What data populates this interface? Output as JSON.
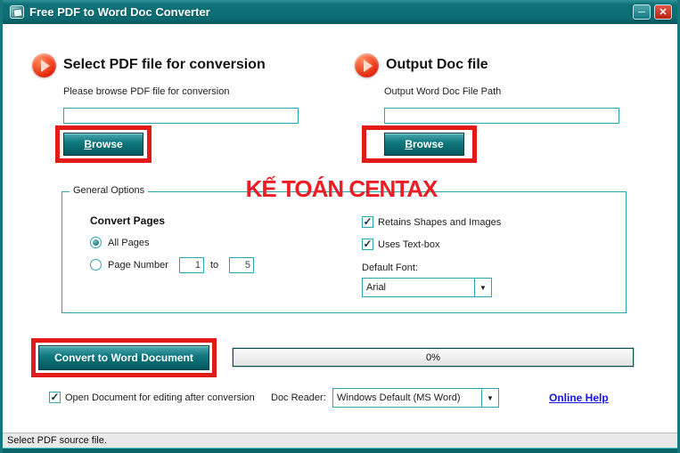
{
  "window": {
    "title": "Free PDF to Word Doc Converter"
  },
  "icons": {
    "minimize": "─",
    "close": "✕",
    "dropdown_arrow": "▼",
    "check": "✓"
  },
  "sections": {
    "pdf": {
      "heading": "Select PDF file for conversion",
      "label": "Please browse PDF file for conversion",
      "input_value": "",
      "browse_underletter": "B",
      "browse_rest": "rowse"
    },
    "doc": {
      "heading": "Output Doc file",
      "label": "Output Word Doc File Path",
      "input_value": "",
      "browse_underletter": "B",
      "browse_rest": "rowse"
    }
  },
  "watermark": "KẾ TOÁN CENTAX",
  "general_options": {
    "legend": "General Options",
    "convert_pages_label": "Convert Pages",
    "all_pages_label": "All Pages",
    "page_number_label": "Page Number",
    "page_from": "1",
    "to_label": "to",
    "page_to": "5",
    "retains_label": "Retains Shapes and Images",
    "textbox_label": "Uses Text-box",
    "default_font_label": "Default Font:",
    "default_font_value": "Arial"
  },
  "actions": {
    "convert_label": "Convert to Word Document",
    "progress_value": "0%",
    "open_doc_label": "Open Document for editing after conversion",
    "doc_reader_label": "Doc Reader:",
    "doc_reader_value": "Windows Default (MS Word)",
    "online_help_label": "Online Help"
  },
  "status_bar": {
    "text": "Select PDF source file."
  },
  "colors": {
    "titlebar_teal": "#0c6d73",
    "accent_teal": "#2aa7ad",
    "button_teal": "#117a80",
    "highlight_red": "#e31a17",
    "watermark_red": "#ee1c25",
    "close_red": "#b91f10",
    "link_blue": "#1714ef"
  }
}
